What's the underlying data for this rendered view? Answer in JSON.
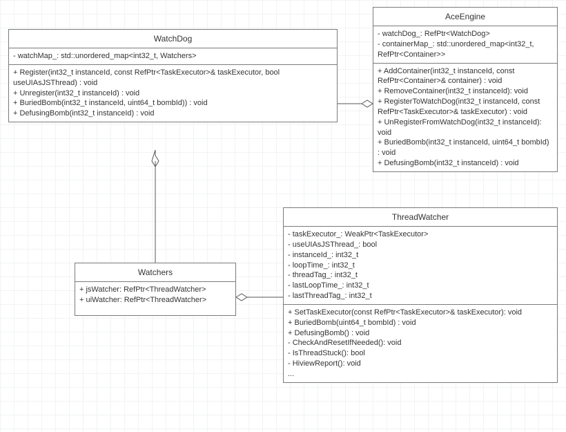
{
  "classes": {
    "watchdog": {
      "title": "WatchDog",
      "attrs": [
        "- watchMap_: std::unordered_map<int32_t, Watchers>"
      ],
      "ops": [
        "+ Register(int32_t instanceId, const RefPtr<TaskExecutor>& taskExecutor, bool useUIAsJSThread) : void",
        "+ Unregister(int32_t instanceId) : void",
        "+ BuriedBomb(int32_t instanceId, uint64_t bombId)) : void",
        "+ DefusingBomb(int32_t instanceId) : void"
      ]
    },
    "aceengine": {
      "title": "AceEngine",
      "attrs": [
        "- watchDog_: RefPtr<WatchDog>",
        "- containerMap_: std::unordered_map<int32_t, RefPtr<Container>>"
      ],
      "ops": [
        "+ AddContainer(int32_t instanceId, const RefPtr<Container>& container) : void",
        "+ RemoveContainer(int32_t instanceId): void",
        "+ RegisterToWatchDog(int32_t instanceId, const RefPtr<TaskExecutor>& taskExecutor) : void",
        "+ UnRegisterFromWatchDog(int32_t instanceId): void",
        "+ BuriedBomb(int32_t instanceId, uint64_t bombId) : void",
        "+ DefusingBomb(int32_t instanceId) : void"
      ]
    },
    "watchers": {
      "title": "Watchers",
      "attrs": [],
      "ops": [
        "+ jsWatcher: RefPtr<ThreadWatcher>",
        "+ uiWatcher: RefPtr<ThreadWatcher>"
      ]
    },
    "threadwatcher": {
      "title": "ThreadWatcher",
      "attrs": [
        "- taskExecutor_: WeakPtr<TaskExecutor>",
        "- useUIAsJSThread_: bool",
        "- instanceId_: int32_t",
        "- loopTime_: int32_t",
        "- threadTag_: int32_t",
        "- lastLoopTime_: int32_t",
        "- lastThreadTag_: int32_t"
      ],
      "ops": [
        "+ SetTaskExecutor(const RefPtr<TaskExecutor>& taskExecutor):  void",
        "+ BuriedBomb(uint64_t bombId) : void",
        "+ DefusingBomb() : void",
        "- CheckAndResetIfNeeded(): void",
        "- IsThreadStuck(): bool",
        "- HiviewReport(): void",
        "..."
      ]
    }
  }
}
